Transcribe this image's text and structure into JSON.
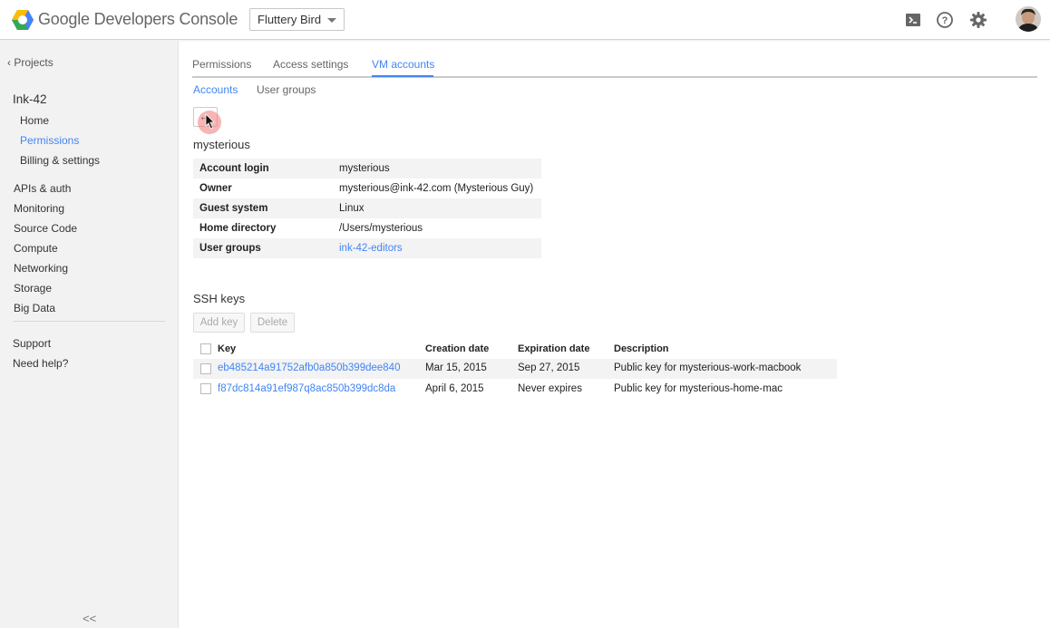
{
  "header": {
    "brand": "Google Developers Console",
    "project_selector": "Fluttery Bird",
    "icons": [
      "terminal-icon",
      "help-icon",
      "settings-icon"
    ]
  },
  "sidebar": {
    "back_label": "Projects",
    "back_glyph": "‹",
    "project_name": "Ink-42",
    "project_items": [
      {
        "label": "Home",
        "active": false
      },
      {
        "label": "Permissions",
        "active": true
      },
      {
        "label": "Billing & settings",
        "active": false
      }
    ],
    "sections": [
      "APIs & auth",
      "Monitoring",
      "Source Code",
      "Compute",
      "Networking",
      "Storage",
      "Big Data"
    ],
    "footer": [
      "Support",
      "Need help?"
    ],
    "collapse_glyph": "<<"
  },
  "tabs": [
    {
      "label": "Permissions",
      "active": false
    },
    {
      "label": "Access settings",
      "active": false
    },
    {
      "label": "VM accounts",
      "active": true
    }
  ],
  "subtabs": [
    {
      "label": "Accounts",
      "active": true
    },
    {
      "label": "User groups",
      "active": false
    }
  ],
  "account": {
    "name": "mysterious",
    "details": [
      {
        "key": "Account login",
        "value": "mysterious"
      },
      {
        "key": "Owner",
        "value": "mysterious@ink-42.com (Mysterious Guy)"
      },
      {
        "key": "Guest system",
        "value": "Linux"
      },
      {
        "key": "Home directory",
        "value": "/Users/mysterious"
      },
      {
        "key": "User groups",
        "value": "ink-42-editors"
      }
    ]
  },
  "ssh": {
    "title": "SSH keys",
    "add_key": "Add key",
    "delete": "Delete",
    "columns": [
      "Key",
      "Creation date",
      "Expiration date",
      "Description"
    ],
    "rows": [
      {
        "key": "eb485214a91752afb0a850b399dee840",
        "created": "Mar 15, 2015",
        "expires": "Sep 27, 2015",
        "description": "Public key for mysterious-work-macbook"
      },
      {
        "key": "f87dc814a91ef987q8ac850b399dc8da",
        "created": "April 6, 2015",
        "expires": "Never expires",
        "description": "Public key for mysterious-home-mac"
      }
    ]
  },
  "colors": {
    "accent": "#4285f4",
    "sidebar_bg": "#f2f2f2"
  }
}
